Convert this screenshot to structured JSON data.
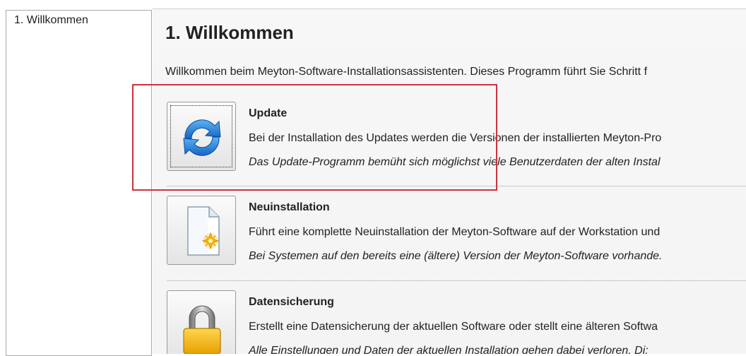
{
  "steps": {
    "items": [
      "1. Willkommen"
    ]
  },
  "page": {
    "title": "1. Willkommen",
    "intro": "Willkommen beim Meyton-Software-Installationsassistenten. Dieses Programm führt Sie Schritt f"
  },
  "options": [
    {
      "name": "update",
      "icon": "refresh-arrows-icon",
      "heading": "Update",
      "description": "Bei der Installation des Updates werden die Versionen der installierten Meyton-Pro",
      "note": "Das Update-Programm bemüht sich möglichst viele Benutzerdaten der alten Instal"
    },
    {
      "name": "new-install",
      "icon": "new-document-icon",
      "heading": "Neuinstallation",
      "description": "Führt eine komplette Neuinstallation der Meyton-Software auf der Workstation und",
      "note": "Bei Systemen auf den bereits eine (ältere) Version der Meyton-Software vorhande."
    },
    {
      "name": "backup",
      "icon": "padlock-icon",
      "heading": "Datensicherung",
      "description": "Erstellt eine Datensicherung der aktuellen Software oder stellt eine älteren Softwa",
      "note": "Alle Einstellungen und Daten der aktuellen Installation gehen dabei verloren. Di:"
    }
  ],
  "colors": {
    "highlight": "#cc3340",
    "update_blue": "#1e88e5"
  }
}
